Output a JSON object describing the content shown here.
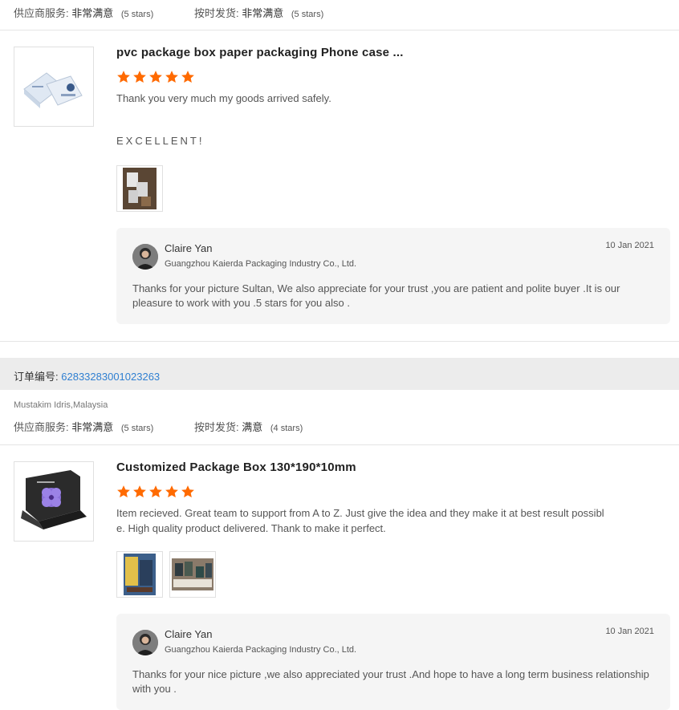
{
  "review1": {
    "supplier_service_label": "供应商服务:",
    "supplier_service_value": "非常满意",
    "supplier_service_stars": "(5 stars)",
    "shipping_label": "按时发货:",
    "shipping_value": "非常满意",
    "shipping_stars": "(5 stars)",
    "product_title": "pvc package box paper packaging Phone case ...",
    "rating": 5,
    "comment": "Thank you very much my goods arrived safely.",
    "extra_comment": "EXCELLENT!",
    "reply": {
      "name": "Claire Yan",
      "company": "Guangzhou Kaierda Packaging Industry Co., Ltd.",
      "date": "10 Jan 2021",
      "text": "Thanks for your picture Sultan, We also appreciate for your trust ,you are patient and polite buyer .It is our pleasure to work with you .5 stars for you also ."
    }
  },
  "order": {
    "label": "订单编号:",
    "number": "62833283001023263"
  },
  "review2": {
    "buyer": "Mustakim Idris,Malaysia",
    "supplier_service_label": "供应商服务:",
    "supplier_service_value": "非常满意",
    "supplier_service_stars": "(5 stars)",
    "shipping_label": "按时发货:",
    "shipping_value": "满意",
    "shipping_stars": "(4 stars)",
    "product_title": "Customized Package Box 130*190*10mm",
    "rating": 5,
    "comment_line1": "Item recieved. Great team to support from A to Z. Just give the idea and they make it at best result possibl",
    "comment_line2": "e. High quality product delivered. Thank to make it perfect.",
    "reply": {
      "name": "Claire Yan",
      "company": "Guangzhou Kaierda Packaging Industry Co., Ltd.",
      "date": "10 Jan 2021",
      "text": "Thanks for your nice picture ,we also appreciated your trust .And hope to have a long term business relationship with you ."
    }
  },
  "colors": {
    "star": "#ff6a00",
    "link": "#2f7fd1"
  }
}
